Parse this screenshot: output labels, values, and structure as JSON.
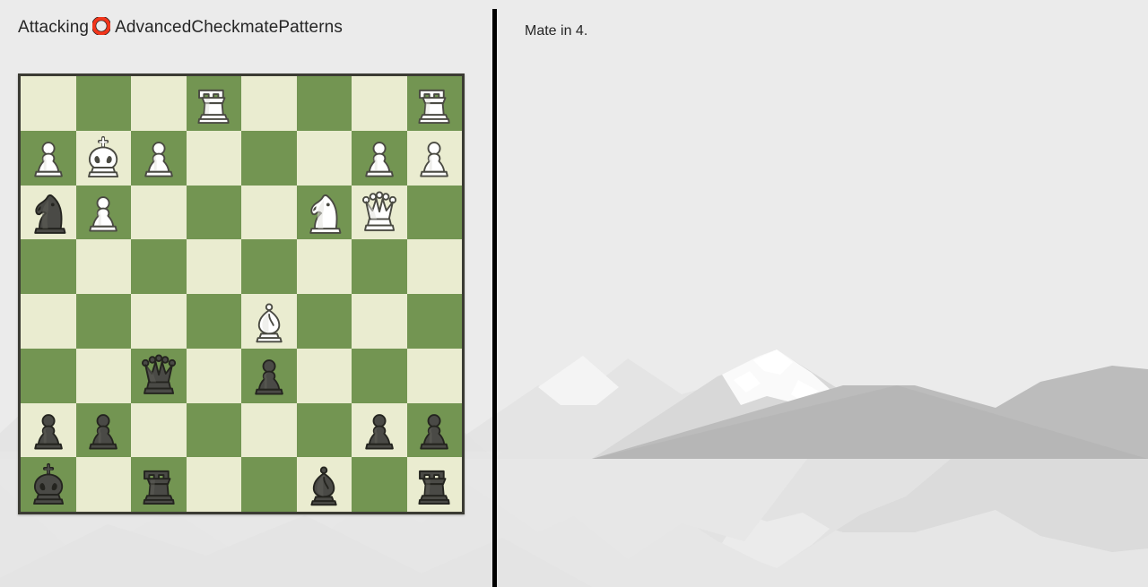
{
  "page": {
    "background_color": "#ebebeb",
    "divider_color": "#000000"
  },
  "left_pane": {
    "title_prefix": "Attacking",
    "title_icon": "red-ring-icon",
    "title_icon_color": "#f0361c",
    "title_suffix": "AdvancedCheckmatePatterns"
  },
  "right_pane": {
    "prompt": "Mate in 4."
  },
  "board": {
    "light_square_color": "#eaecd0",
    "dark_square_color": "#739552",
    "border_color": "#3b3b33",
    "files": [
      "a",
      "b",
      "c",
      "d",
      "e",
      "f",
      "g",
      "h"
    ],
    "ranks": [
      8,
      7,
      6,
      5,
      4,
      3,
      2,
      1
    ],
    "orientation": "white-bottom",
    "fen": "3R3R/PKP3PP/nP3NQ1/8/4B3/2q1p3/pp4pp/k1r2b1r",
    "squares": [
      [
        "",
        "",
        "",
        "wR",
        "",
        "",
        "",
        "wR"
      ],
      [
        "wP",
        "wK",
        "wP",
        "",
        "",
        "",
        "wP",
        "wP"
      ],
      [
        "bN",
        "wP",
        "",
        "",
        "",
        "wN",
        "wQ",
        ""
      ],
      [
        "",
        "",
        "",
        "",
        "",
        "",
        "",
        ""
      ],
      [
        "",
        "",
        "",
        "",
        "wB",
        "",
        "",
        ""
      ],
      [
        "",
        "",
        "bQ",
        "",
        "bP",
        "",
        "",
        ""
      ],
      [
        "bP",
        "bP",
        "",
        "",
        "",
        "",
        "bP",
        "bP"
      ],
      [
        "bK",
        "",
        "bR",
        "",
        "",
        "bB",
        "",
        "bR"
      ]
    ],
    "piece_names": {
      "wK": "white-king",
      "wQ": "white-queen",
      "wR": "white-rook",
      "wB": "white-bishop",
      "wN": "white-knight",
      "wP": "white-pawn",
      "bK": "black-king",
      "bQ": "black-queen",
      "bR": "black-rook",
      "bB": "black-bishop",
      "bN": "black-knight",
      "bP": "black-pawn"
    }
  }
}
